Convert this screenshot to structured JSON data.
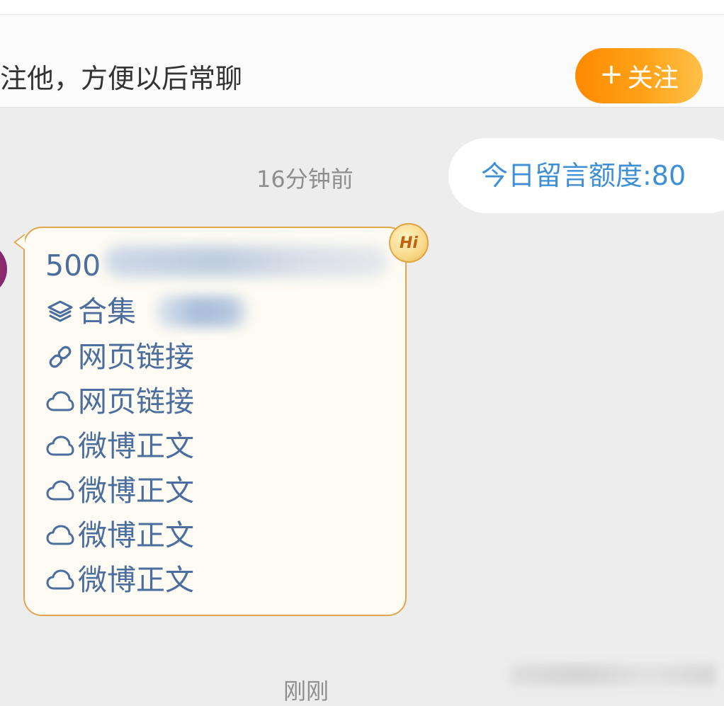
{
  "follow_bar": {
    "prompt_text": "注他，方便以后常聊",
    "follow_button_plus": "+",
    "follow_button_label": "关注"
  },
  "chat": {
    "timestamp": "16分钟前",
    "quota_text": "今日留言额度:80",
    "hi_badge": "Hi",
    "message": {
      "first_line_visible": "500",
      "items": [
        {
          "icon": "layers-icon",
          "text": "合集"
        },
        {
          "icon": "link-icon",
          "text": "网页链接"
        },
        {
          "icon": "weibo-cloud-icon",
          "text": "网页链接"
        },
        {
          "icon": "weibo-cloud-icon",
          "text": "微博正文"
        },
        {
          "icon": "weibo-cloud-icon",
          "text": "微博正文"
        },
        {
          "icon": "weibo-cloud-icon",
          "text": "微博正文"
        },
        {
          "icon": "weibo-cloud-icon",
          "text": "微博正文"
        }
      ]
    },
    "bottom_timestamp": "刚刚"
  },
  "colors": {
    "link_text": "#4b6e9e",
    "quota_text": "#3e8fd6",
    "bubble_border": "#e1a64c",
    "bubble_bg": "#fdfbf3",
    "follow_gradient_start": "#ff8a00",
    "follow_gradient_end": "#ffc04a"
  }
}
